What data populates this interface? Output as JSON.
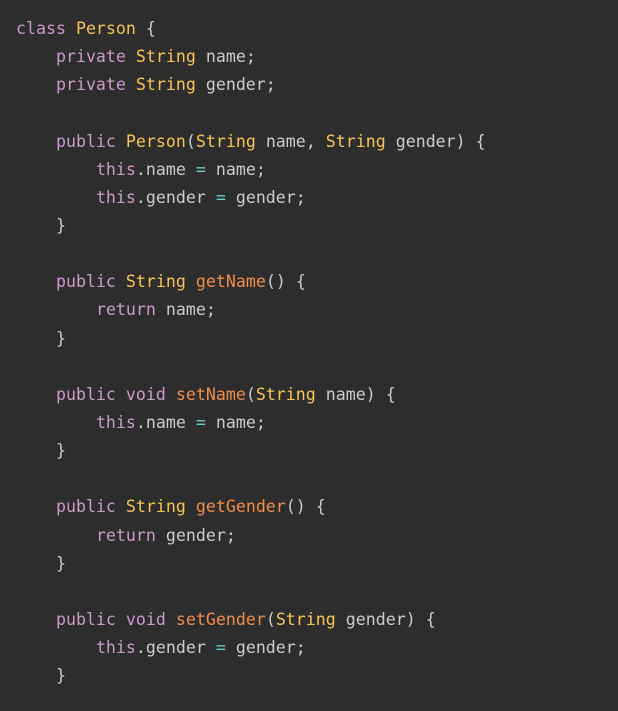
{
  "language": "java",
  "colors": {
    "background": "#2d2d2d",
    "keyword": "#cc99cd",
    "class": "#f8c555",
    "function": "#f08d49",
    "operator": "#67cdcc",
    "text": "#cccccc"
  },
  "lines": [
    [
      [
        "keyword",
        "class"
      ],
      [
        "text",
        " "
      ],
      [
        "class",
        "Person"
      ],
      [
        "text",
        " "
      ],
      [
        "punct",
        "{"
      ]
    ],
    [
      [
        "text",
        "    "
      ],
      [
        "keyword",
        "private"
      ],
      [
        "text",
        " "
      ],
      [
        "class",
        "String"
      ],
      [
        "text",
        " name"
      ],
      [
        "punct",
        ";"
      ]
    ],
    [
      [
        "text",
        "    "
      ],
      [
        "keyword",
        "private"
      ],
      [
        "text",
        " "
      ],
      [
        "class",
        "String"
      ],
      [
        "text",
        " gender"
      ],
      [
        "punct",
        ";"
      ]
    ],
    [],
    [
      [
        "text",
        "    "
      ],
      [
        "keyword",
        "public"
      ],
      [
        "text",
        " "
      ],
      [
        "class",
        "Person"
      ],
      [
        "punct",
        "("
      ],
      [
        "class",
        "String"
      ],
      [
        "text",
        " name"
      ],
      [
        "punct",
        ","
      ],
      [
        "text",
        " "
      ],
      [
        "class",
        "String"
      ],
      [
        "text",
        " gender"
      ],
      [
        "punct",
        ")"
      ],
      [
        "text",
        " "
      ],
      [
        "punct",
        "{"
      ]
    ],
    [
      [
        "text",
        "        "
      ],
      [
        "keyword",
        "this"
      ],
      [
        "punct",
        "."
      ],
      [
        "text",
        "name "
      ],
      [
        "operator",
        "="
      ],
      [
        "text",
        " name"
      ],
      [
        "punct",
        ";"
      ]
    ],
    [
      [
        "text",
        "        "
      ],
      [
        "keyword",
        "this"
      ],
      [
        "punct",
        "."
      ],
      [
        "text",
        "gender "
      ],
      [
        "operator",
        "="
      ],
      [
        "text",
        " gender"
      ],
      [
        "punct",
        ";"
      ]
    ],
    [
      [
        "text",
        "    "
      ],
      [
        "punct",
        "}"
      ]
    ],
    [],
    [
      [
        "text",
        "    "
      ],
      [
        "keyword",
        "public"
      ],
      [
        "text",
        " "
      ],
      [
        "class",
        "String"
      ],
      [
        "text",
        " "
      ],
      [
        "function",
        "getName"
      ],
      [
        "punct",
        "("
      ],
      [
        "punct",
        ")"
      ],
      [
        "text",
        " "
      ],
      [
        "punct",
        "{"
      ]
    ],
    [
      [
        "text",
        "        "
      ],
      [
        "keyword",
        "return"
      ],
      [
        "text",
        " name"
      ],
      [
        "punct",
        ";"
      ]
    ],
    [
      [
        "text",
        "    "
      ],
      [
        "punct",
        "}"
      ]
    ],
    [],
    [
      [
        "text",
        "    "
      ],
      [
        "keyword",
        "public"
      ],
      [
        "text",
        " "
      ],
      [
        "keyword",
        "void"
      ],
      [
        "text",
        " "
      ],
      [
        "function",
        "setName"
      ],
      [
        "punct",
        "("
      ],
      [
        "class",
        "String"
      ],
      [
        "text",
        " name"
      ],
      [
        "punct",
        ")"
      ],
      [
        "text",
        " "
      ],
      [
        "punct",
        "{"
      ]
    ],
    [
      [
        "text",
        "        "
      ],
      [
        "keyword",
        "this"
      ],
      [
        "punct",
        "."
      ],
      [
        "text",
        "name "
      ],
      [
        "operator",
        "="
      ],
      [
        "text",
        " name"
      ],
      [
        "punct",
        ";"
      ]
    ],
    [
      [
        "text",
        "    "
      ],
      [
        "punct",
        "}"
      ]
    ],
    [],
    [
      [
        "text",
        "    "
      ],
      [
        "keyword",
        "public"
      ],
      [
        "text",
        " "
      ],
      [
        "class",
        "String"
      ],
      [
        "text",
        " "
      ],
      [
        "function",
        "getGender"
      ],
      [
        "punct",
        "("
      ],
      [
        "punct",
        ")"
      ],
      [
        "text",
        " "
      ],
      [
        "punct",
        "{"
      ]
    ],
    [
      [
        "text",
        "        "
      ],
      [
        "keyword",
        "return"
      ],
      [
        "text",
        " gender"
      ],
      [
        "punct",
        ";"
      ]
    ],
    [
      [
        "text",
        "    "
      ],
      [
        "punct",
        "}"
      ]
    ],
    [],
    [
      [
        "text",
        "    "
      ],
      [
        "keyword",
        "public"
      ],
      [
        "text",
        " "
      ],
      [
        "keyword",
        "void"
      ],
      [
        "text",
        " "
      ],
      [
        "function",
        "setGender"
      ],
      [
        "punct",
        "("
      ],
      [
        "class",
        "String"
      ],
      [
        "text",
        " gender"
      ],
      [
        "punct",
        ")"
      ],
      [
        "text",
        " "
      ],
      [
        "punct",
        "{"
      ]
    ],
    [
      [
        "text",
        "        "
      ],
      [
        "keyword",
        "this"
      ],
      [
        "punct",
        "."
      ],
      [
        "text",
        "gender "
      ],
      [
        "operator",
        "="
      ],
      [
        "text",
        " gender"
      ],
      [
        "punct",
        ";"
      ]
    ],
    [
      [
        "text",
        "    "
      ],
      [
        "punct",
        "}"
      ]
    ]
  ]
}
